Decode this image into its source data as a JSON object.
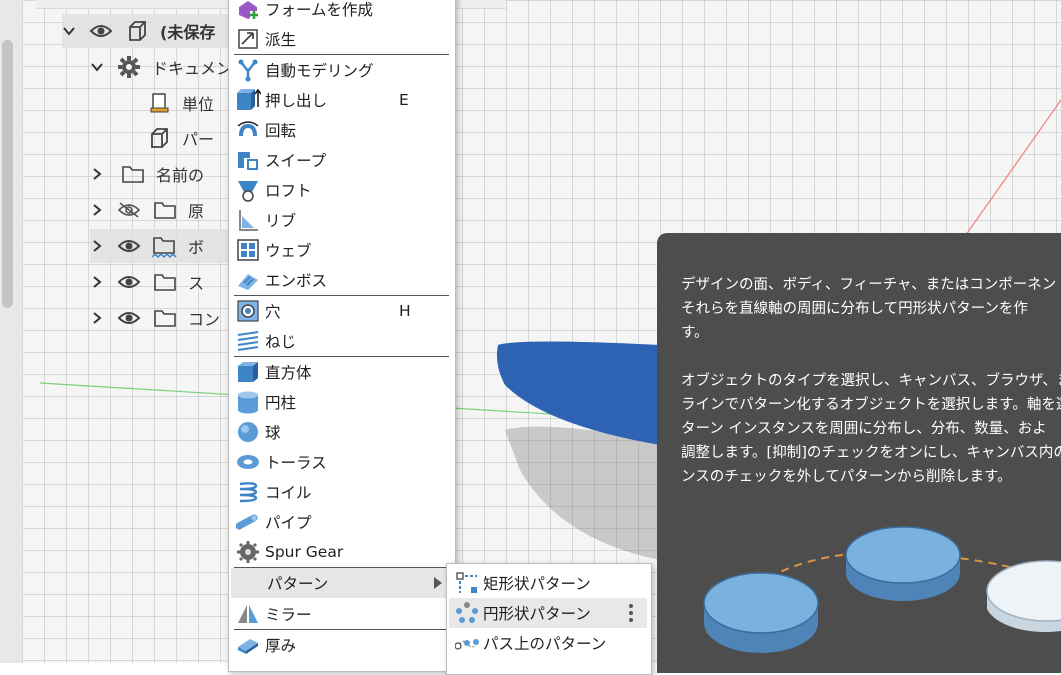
{
  "browser": {
    "root_label": "(未保存",
    "items": [
      {
        "label": "ドキュメン"
      },
      {
        "label": "単位"
      },
      {
        "label": "パー"
      },
      {
        "label": "名前の"
      },
      {
        "label": "原"
      },
      {
        "label": "ボ"
      },
      {
        "label": "ス"
      },
      {
        "label": "コン"
      }
    ]
  },
  "menu": {
    "items": [
      {
        "label": "フォームを作成",
        "icon": "create-form-icon"
      },
      {
        "label": "派生",
        "icon": "derive-icon"
      },
      {
        "label": "自動モデリング",
        "icon": "automated-modeling-icon"
      },
      {
        "label": "押し出し",
        "shortcut": "E",
        "icon": "extrude-icon"
      },
      {
        "label": "回転",
        "icon": "revolve-icon"
      },
      {
        "label": "スイープ",
        "icon": "sweep-icon"
      },
      {
        "label": "ロフト",
        "icon": "loft-icon"
      },
      {
        "label": "リブ",
        "icon": "rib-icon"
      },
      {
        "label": "ウェブ",
        "icon": "web-icon"
      },
      {
        "label": "エンボス",
        "icon": "emboss-icon"
      },
      {
        "label": "穴",
        "shortcut": "H",
        "icon": "hole-icon"
      },
      {
        "label": "ねじ",
        "icon": "thread-icon"
      },
      {
        "label": "直方体",
        "icon": "box-icon"
      },
      {
        "label": "円柱",
        "icon": "cylinder-icon"
      },
      {
        "label": "球",
        "icon": "sphere-icon"
      },
      {
        "label": "トーラス",
        "icon": "torus-icon"
      },
      {
        "label": "コイル",
        "icon": "coil-icon"
      },
      {
        "label": "パイプ",
        "icon": "pipe-icon"
      },
      {
        "label": "Spur Gear",
        "icon": "spur-gear-icon"
      },
      {
        "label": "パターン",
        "icon": "",
        "has_submenu": true
      },
      {
        "label": "ミラー",
        "icon": "mirror-icon"
      },
      {
        "label": "厚み",
        "icon": "thicken-icon"
      }
    ]
  },
  "submenu": {
    "items": [
      {
        "label": "矩形状パターン",
        "icon": "rectangular-pattern-icon"
      },
      {
        "label": "円形状パターン",
        "icon": "circular-pattern-icon",
        "highlighted": true
      },
      {
        "label": "パス上のパターン",
        "icon": "path-pattern-icon"
      }
    ]
  },
  "tooltip": {
    "para1_line1": "デザインの面、ボディ、フィーチャ、またはコンポーネントを",
    "para1_line2": "それらを直線軸の周囲に分布して円形状パターンを作",
    "para1_line3": "す。",
    "para2_line1": "オブジェクトのタイプを選択し、キャンバス、ブラウザ、また",
    "para2_line2": "ラインでパターン化するオブジェクトを選択します。軸を選",
    "para2_line3": "ターン インスタンスを周囲に分布し、分布、数量、およ",
    "para2_line4": "調整します。[抑制]のチェックをオンにし、キャンバス内の",
    "para2_line5": "ンスのチェックを外してパターンから削除します。"
  },
  "colors": {
    "accent_blue": "#3d85c6",
    "body_blue": "#2e62b3",
    "tooltip_bg": "#4d4d4d",
    "menu_highlight": "#e6e6e6"
  }
}
